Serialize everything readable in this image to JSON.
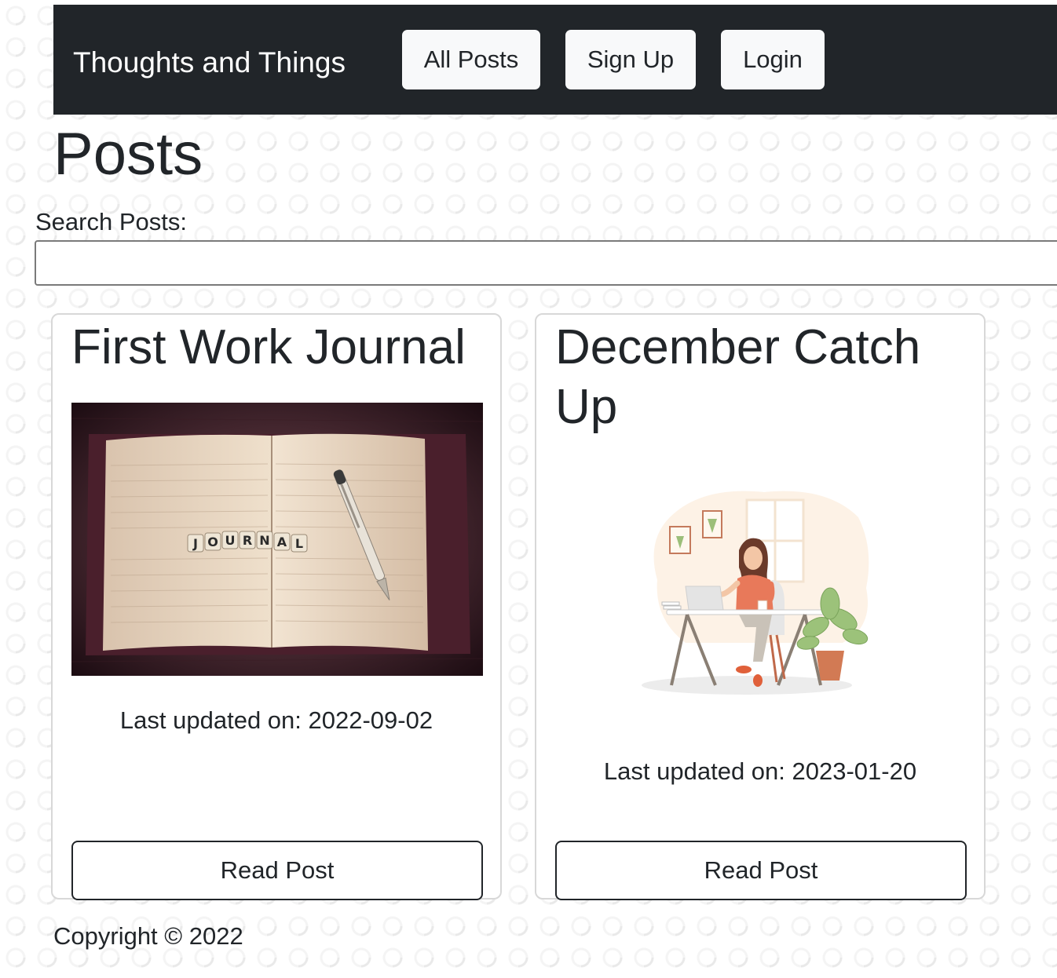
{
  "navbar": {
    "brand": "Thoughts and Things",
    "links": [
      {
        "label": "All Posts"
      },
      {
        "label": "Sign Up"
      },
      {
        "label": "Login"
      }
    ]
  },
  "page": {
    "title": "Posts"
  },
  "search": {
    "label": "Search Posts:",
    "value": "",
    "placeholder": ""
  },
  "posts": [
    {
      "title": "First Work Journal",
      "image_alt": "Open notebook with letter tiles spelling JOURNAL and a pen",
      "image_tiles": [
        "J",
        "O",
        "U",
        "R",
        "N",
        "A",
        "L"
      ],
      "last_updated": "Last updated on: 2022-09-02",
      "button_label": "Read Post"
    },
    {
      "title": "December Catch Up",
      "image_alt": "Illustration of a woman working on a laptop at a desk",
      "last_updated": "Last updated on: 2023-01-20",
      "button_label": "Read Post"
    }
  ],
  "footer": {
    "copyright": "Copyright © 2022"
  },
  "colors": {
    "navbar_bg": "#212529",
    "nav_button_bg": "#f8f9fa",
    "text": "#212529",
    "card_border": "#d8d8d8"
  }
}
